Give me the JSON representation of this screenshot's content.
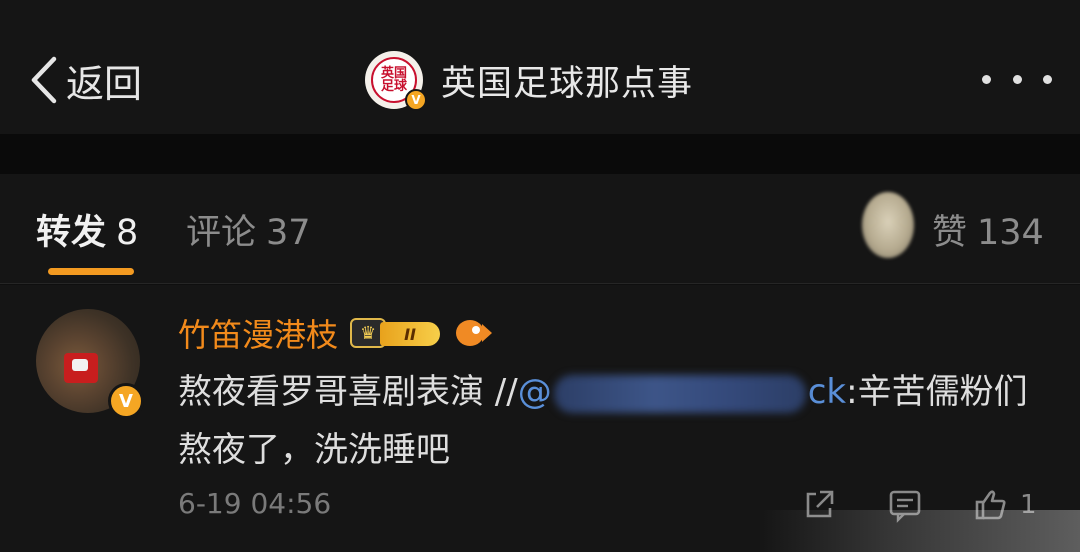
{
  "header": {
    "back_label": "返回",
    "title": "英国足球那点事",
    "logo_text_top": "英国",
    "logo_text_bottom": "足球",
    "verified_mark": "V"
  },
  "tabs": {
    "repost": {
      "label": "转发",
      "count": "8"
    },
    "comment": {
      "label": "评论",
      "count": "37"
    },
    "like": {
      "label": "赞",
      "count": "134"
    }
  },
  "comment": {
    "username": "竹笛漫港枝",
    "level_badge": "II",
    "verified_mark": "V",
    "text_before": "熬夜看罗哥喜剧表演 //",
    "mention_visible_start": "@",
    "mention_visible_end": "ck",
    "text_after": ":辛苦儒粉们熬夜了，洗洗睡吧",
    "time": "6-19 04:56",
    "like_count": "1"
  },
  "colors": {
    "accent_orange": "#f39a21",
    "username_orange": "#f28a1b",
    "mention_blue": "#5a8fd8",
    "verified_gold": "#f5a623"
  },
  "icons": {
    "back": "chevron-left-icon",
    "more": "more-horizontal-icon",
    "share": "share-icon",
    "comment": "comment-icon",
    "like": "thumbs-up-icon"
  }
}
